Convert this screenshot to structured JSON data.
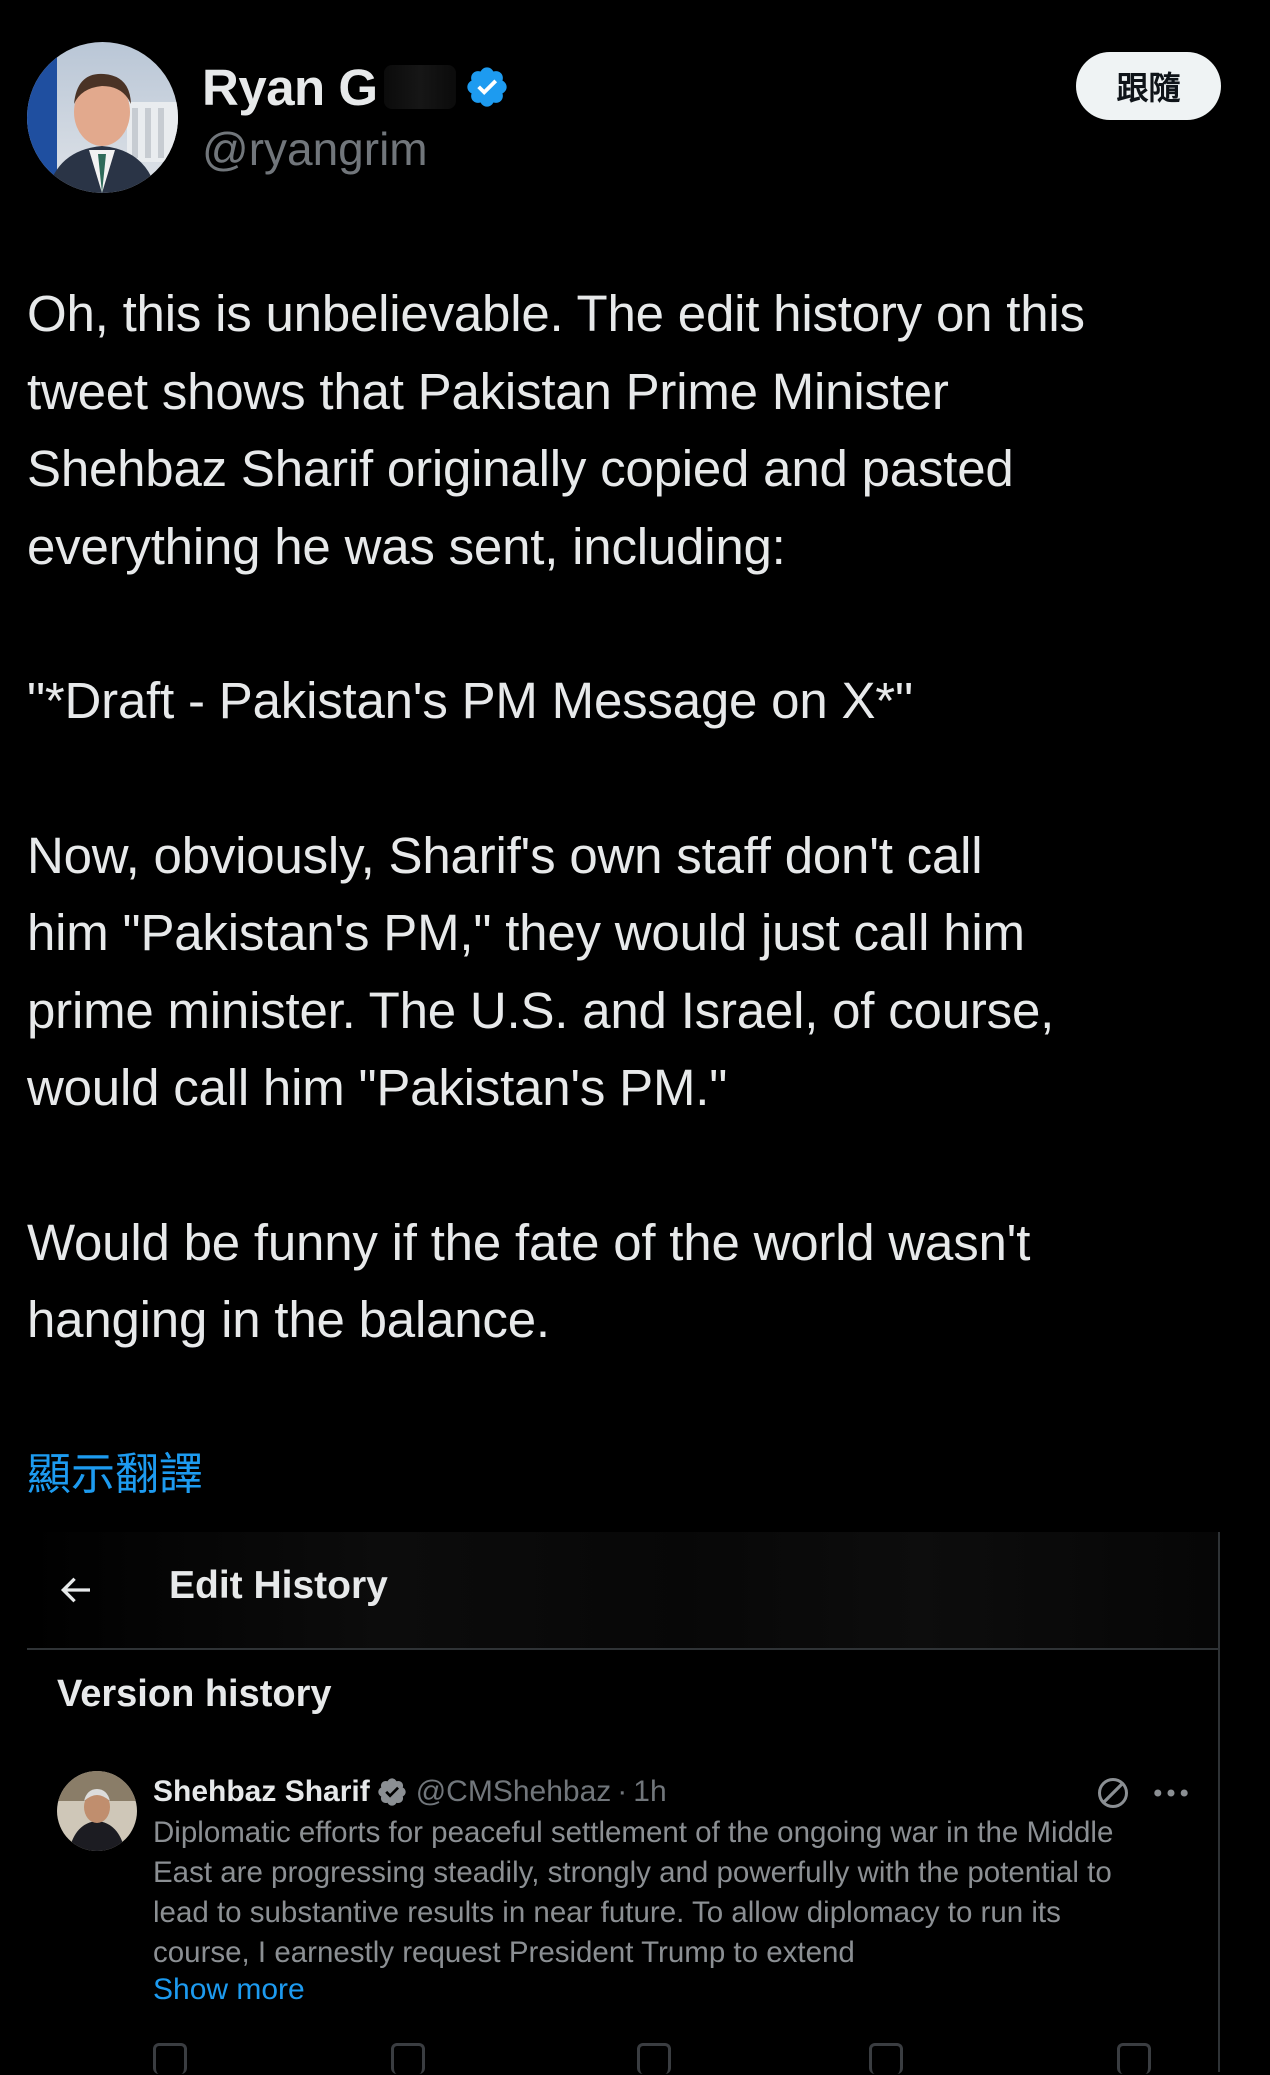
{
  "author": {
    "display_name": "Ryan G",
    "handle": "@ryangrim",
    "verified": true
  },
  "follow_label": "跟隨",
  "tweet": {
    "paragraphs": [
      "Oh, this is unbelievable. The edit history on this\ntweet shows that Pakistan Prime Minister\nShehbaz Sharif originally copied and pasted\neverything he was sent, including:",
      "\"*Draft - Pakistan's PM Message on X*\"",
      "Now, obviously, Sharif's own staff don't call\nhim \"Pakistan's PM,\" they would just call him\nprime minister. The U.S. and Israel, of course,\nwould call him \"Pakistan's PM.\"",
      "Would be funny if the fate of the world wasn't\nhanging in the balance."
    ]
  },
  "translate_label": "顯示翻譯",
  "embedded": {
    "header_title": "Edit History",
    "section_title": "Version history",
    "post": {
      "name": "Shehbaz Sharif",
      "handle": "@CMShehbaz",
      "separator": "·",
      "time": "1h",
      "text": "Diplomatic efforts for peaceful settlement of the ongoing war in the Middle\nEast are progressing steadily, strongly and powerfully with the potential to\nlead to substantive results in near future. To allow diplomacy to run its\ncourse, I earnestly request President Trump to extend",
      "show_more": "Show more"
    }
  },
  "colors": {
    "background": "#000000",
    "text": "#e7e9ea",
    "muted": "#71767b",
    "link": "#1d9bf0",
    "verified": "#1d9bf0",
    "divider": "#2f3336"
  },
  "icons": {
    "verified": "verified-badge-icon",
    "back": "back-arrow-icon",
    "edit": "edit-pencil-icon",
    "more": "more-options-icon"
  }
}
